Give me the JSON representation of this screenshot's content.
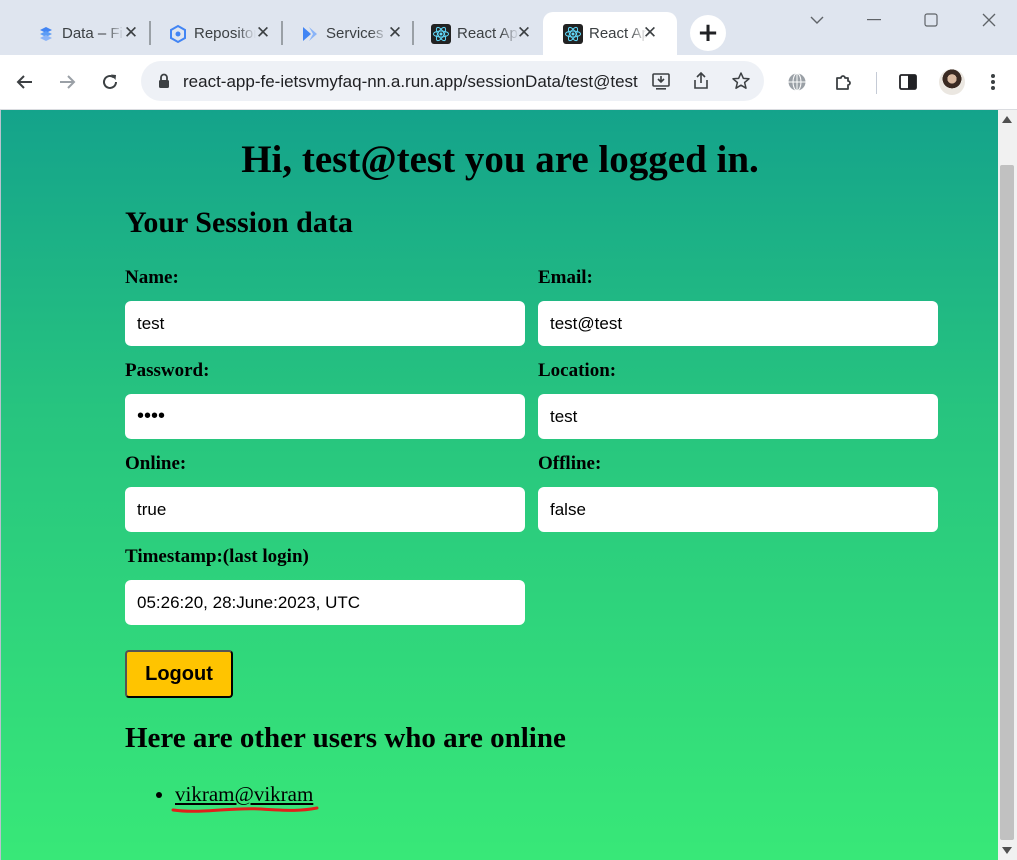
{
  "browser": {
    "tabs": [
      {
        "title": "Data – Firestore",
        "icon": "firestore-icon",
        "active": false
      },
      {
        "title": "Repositories",
        "icon": "artifact-registry-icon",
        "active": false
      },
      {
        "title": "Services",
        "icon": "cloud-run-icon",
        "active": false
      },
      {
        "title": "React App",
        "icon": "react-icon",
        "active": false
      },
      {
        "title": "React App",
        "icon": "react-icon",
        "active": true
      }
    ],
    "url": "react-app-fe-ietsvmyfaq-nn.a.run.app/sessionData/test@test",
    "colors": {
      "tabstrip": "#dfe5ef",
      "toolbar": "#ffffff",
      "omnibox": "#eef1f6"
    }
  },
  "page": {
    "greeting": "Hi, test@test you are logged in.",
    "session_heading": "Your Session data",
    "fields": {
      "name": {
        "label": "Name:",
        "value": "test"
      },
      "email": {
        "label": "Email:",
        "value": "test@test"
      },
      "password": {
        "label": "Password:",
        "value": "••••"
      },
      "location": {
        "label": "Location:",
        "value": "test"
      },
      "online": {
        "label": "Online:",
        "value": "true"
      },
      "offline": {
        "label": "Offline:",
        "value": "false"
      },
      "timestamp": {
        "label": "Timestamp:(last login)",
        "value": "05:26:20, 28:June:2023, UTC"
      }
    },
    "logout_label": "Logout",
    "online_heading": "Here are other users who are online",
    "online_users": [
      "vikram@vikram"
    ],
    "colors": {
      "gradient_top": "#14a38b",
      "gradient_bottom": "#38e878",
      "logout_button": "#ffc400",
      "annotation_underline": "#e0201b"
    }
  }
}
